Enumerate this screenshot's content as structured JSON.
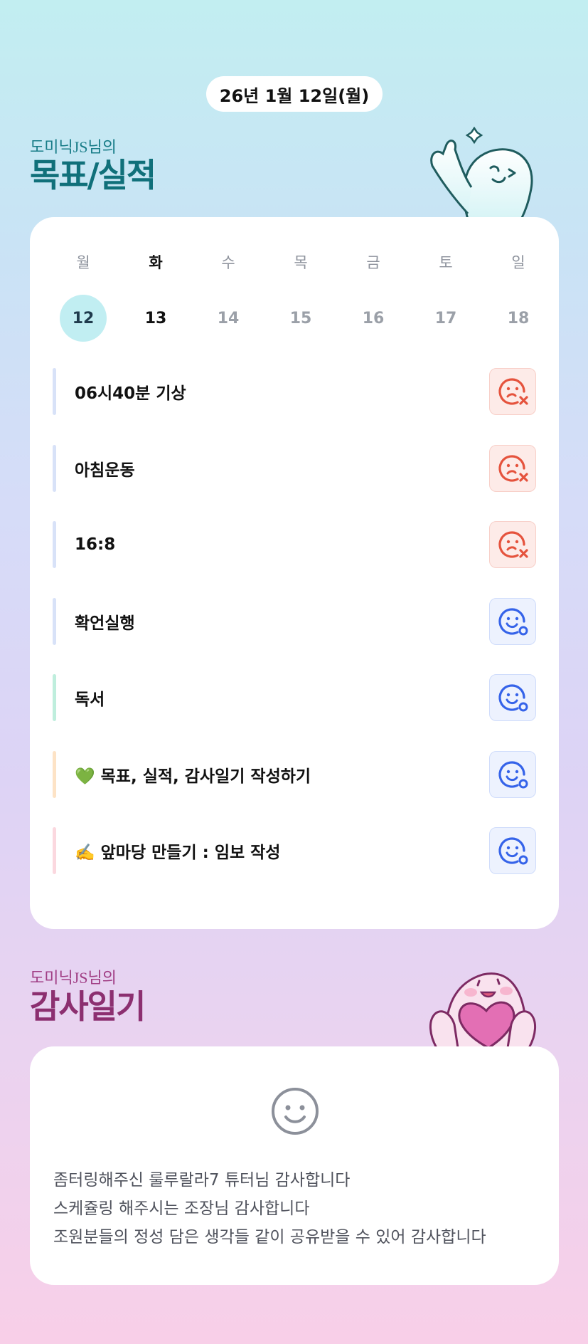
{
  "date_label": "26년 1월 12일(월)",
  "goals_section": {
    "subtitle": "도미닉JS님의",
    "title": "목표/실적"
  },
  "week": {
    "days": [
      "월",
      "화",
      "수",
      "목",
      "금",
      "토",
      "일"
    ],
    "dates": [
      "12",
      "13",
      "14",
      "15",
      "16",
      "17",
      "18"
    ],
    "selected_index": 0,
    "today_index": 1
  },
  "goals": [
    {
      "label": "06시40분 기상",
      "status": "fail",
      "bar_color": "#d8e2f8"
    },
    {
      "label": "아침운동",
      "status": "fail",
      "bar_color": "#d8e2f8"
    },
    {
      "label": "16:8",
      "status": "fail",
      "bar_color": "#d8e2f8"
    },
    {
      "label": "확언실행",
      "status": "done",
      "bar_color": "#d8e2f8"
    },
    {
      "label": "독서",
      "status": "done",
      "bar_color": "#bfeedd"
    },
    {
      "label": "💚 목표, 실적, 감사일기 작성하기",
      "status": "done",
      "bar_color": "#fde3c6"
    },
    {
      "label": "✍️ 앞마당 만들기 : 임보 작성",
      "status": "done",
      "bar_color": "#fbd8df"
    }
  ],
  "gratitude_section": {
    "subtitle": "도미닉JS님의",
    "title": "감사일기",
    "icon": "smile-icon",
    "lines": [
      "좀터링해주신 룰루랄라7 튜터님 감사합니다",
      "스케쥴링 해주시는 조장님 감사합니다",
      "조원분들의 정성 담은 생각들 같이 공유받을 수 있어 감사합니다"
    ]
  },
  "colors": {
    "fail_icon": "#e5533d",
    "done_icon": "#3563e9",
    "goals_title": "#10707a",
    "thanks_title": "#8c2f70"
  }
}
